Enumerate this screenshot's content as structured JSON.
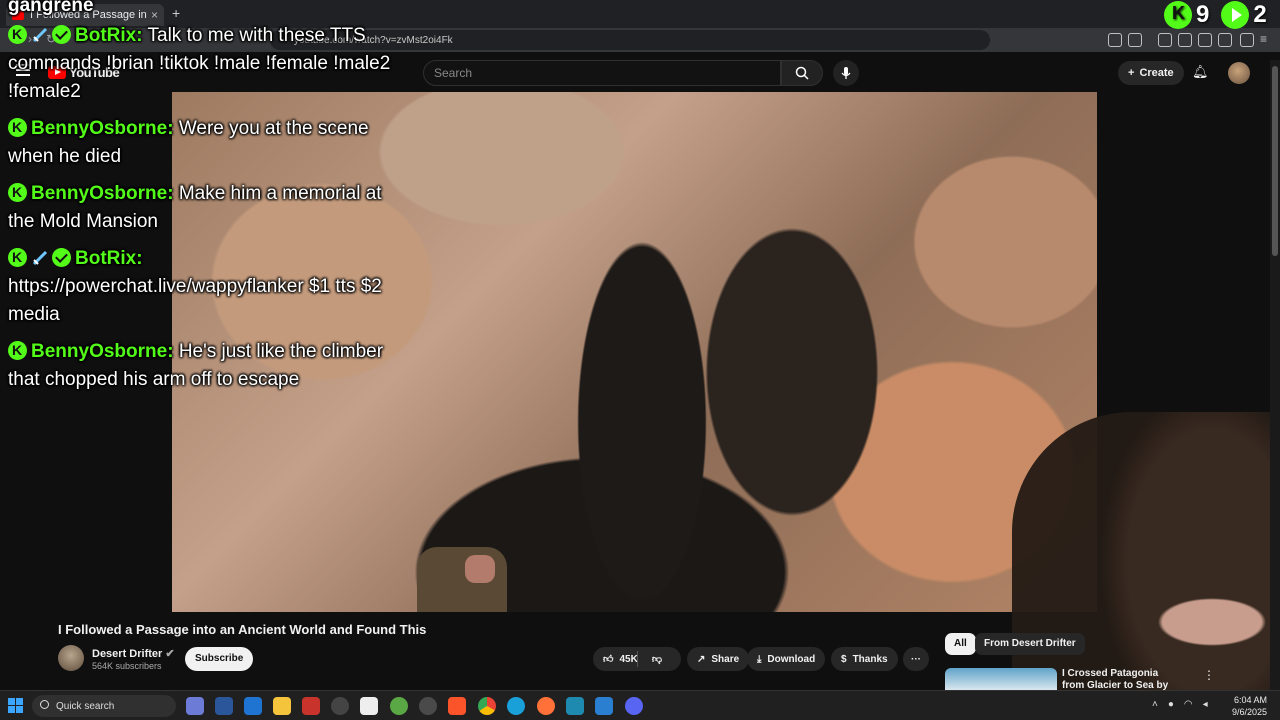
{
  "browser": {
    "tab_title": "I Followed a Passage into an...",
    "new_tab": "+",
    "url": "youtube.com/watch?v=zvMst2oi4Fk"
  },
  "youtube": {
    "logo_text": "YouTube",
    "search_placeholder": "Search",
    "create_label": "Create"
  },
  "chat": {
    "partial_top": "gangrene",
    "messages": [
      {
        "user": "BotRix:",
        "text": "Talk to me with these TTS commands !brian !tiktok !male !female !male2 !female2",
        "bot": true
      },
      {
        "user": "BennyOsborne:",
        "text": "Were you at the scene when he died",
        "bot": false
      },
      {
        "user": "BennyOsborne:",
        "text": "Make him a memorial at the Mold Mansion",
        "bot": false
      },
      {
        "user": "BotRix:",
        "text": "https://powerchat.live/wappyflanker $1 tts $2 media",
        "bot": true
      },
      {
        "user": "BennyOsborne:",
        "text": "He's just like the climber that chopped his arm off to escape",
        "bot": false
      }
    ]
  },
  "counters": {
    "kick_count": "9",
    "rumble_count": "2"
  },
  "video": {
    "title": "I Followed a Passage into an Ancient World and Found This",
    "channel_name": "Desert Drifter",
    "subscribers": "564K subscribers",
    "subscribe_label": "Subscribe",
    "likes": "45K",
    "share_label": "Share",
    "download_label": "Download",
    "thanks_label": "Thanks",
    "more_label": "···"
  },
  "recommendations": {
    "chips": [
      "All",
      "From Desert Drifter"
    ],
    "items": [
      {
        "title": "I Crossed Patagonia from Glacier to Sea by Packraft"
      }
    ]
  },
  "taskbar": {
    "search_label": "Quick search",
    "time": "6:04 AM",
    "date": "9/6/2025"
  },
  "colors": {
    "kick_green": "#53fc18",
    "yt_red": "#ff0000",
    "background": "#0f0f0f"
  }
}
